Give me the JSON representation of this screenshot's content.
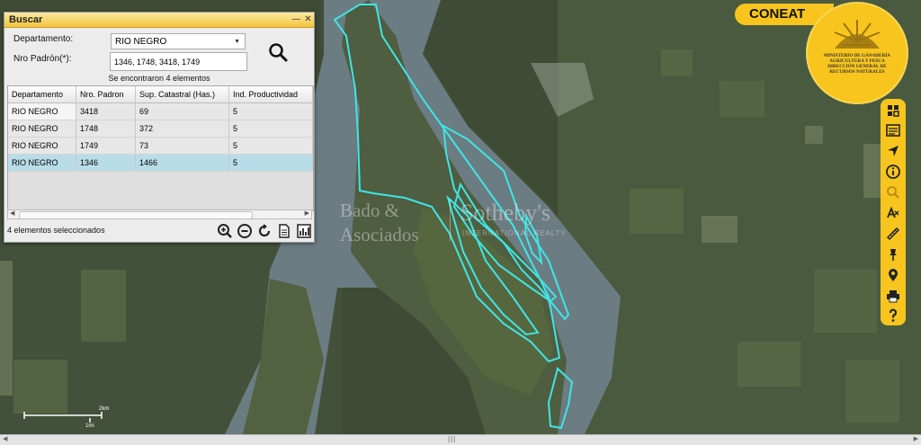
{
  "search_panel": {
    "title": "Buscar",
    "minimize_glyph": "—",
    "close_glyph": "✕",
    "departamento_label": "Departamento:",
    "departamento_value": "RIO NEGRO",
    "padron_label": "Nro Padrón(*):",
    "padron_value": "1346, 1748, 3418, 1749",
    "search_icon": "search-icon",
    "found_text": "Se encontraron 4 elementos",
    "columns": [
      "Departamento",
      "Nro. Padron",
      "Sup. Catastral (Has.)",
      "Ind. Productividad"
    ],
    "rows": [
      [
        "RIO NEGRO",
        "3418",
        "69",
        "5"
      ],
      [
        "RIO NEGRO",
        "1748",
        "372",
        "5"
      ],
      [
        "RIO NEGRO",
        "1749",
        "73",
        "5"
      ],
      [
        "RIO NEGRO",
        "1346",
        "1466",
        "5"
      ]
    ],
    "selected_row_index": 3,
    "selection_text": "4 elementos seleccionados",
    "tools": [
      "zoom-in-icon",
      "zoom-out-icon",
      "redo-icon",
      "document-icon",
      "chart-icon"
    ]
  },
  "branding": {
    "app_name": "CONEAT",
    "logo_text_lines": [
      "MINISTERIO DE GANADERÍA",
      "AGRICULTURA Y PESCA",
      "DIRECCIÓN GENERAL DE",
      "RECURSOS NATURALES"
    ],
    "accent_color": "#f7c51e"
  },
  "map": {
    "watermark_line1": "Bado &",
    "watermark_line2": "Asociados",
    "watermark_brand": "Sotheby's",
    "watermark_sub": "INTERNATIONAL REALTY",
    "scale_km": "2km",
    "scale_mi": "1mi",
    "parcel_outline_color": "#3ee6e6"
  },
  "sidebar_tools": [
    "layers-icon",
    "legend-icon",
    "navigate-icon",
    "info-icon",
    "search-icon",
    "text-icon",
    "measure-icon",
    "pin-icon",
    "location-icon",
    "print-icon",
    "help-icon"
  ]
}
